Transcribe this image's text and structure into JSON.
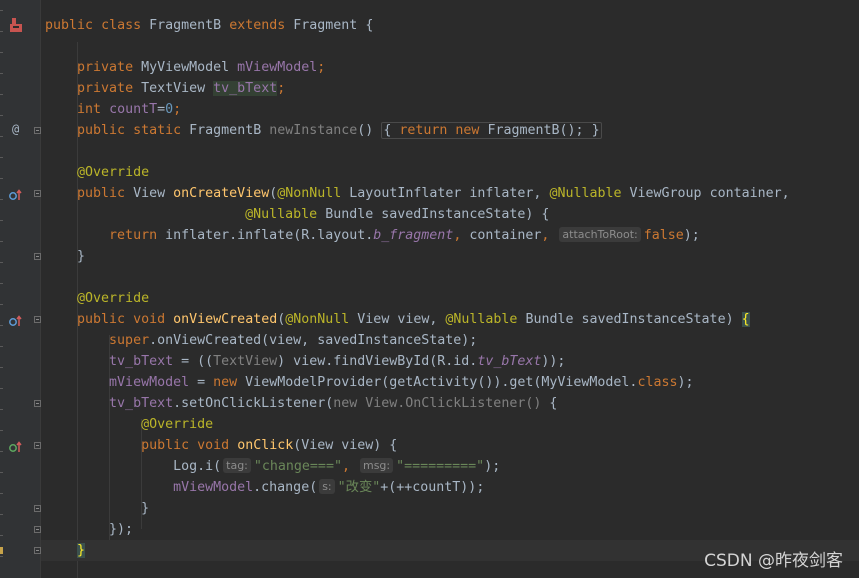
{
  "tokens": {
    "public": "public",
    "private": "private",
    "class": "class",
    "extends": "extends",
    "static": "static",
    "return": "return",
    "new": "new",
    "int": "int",
    "void": "void",
    "super": "super",
    "lbrace": "{",
    "rbrace": "}"
  },
  "code": {
    "l1": {
      "name": "FragmentB",
      "parent": "Fragment"
    },
    "l3": {
      "type": "MyViewModel",
      "field": "mViewModel",
      "semi": ";"
    },
    "l4": {
      "type": "TextView",
      "field": "tv_bText",
      "semi": ";"
    },
    "l5": {
      "field": "countT",
      "eq": "=",
      "num": "0",
      "semi": ";"
    },
    "l6": {
      "ret": "FragmentB",
      "method": "newInstance",
      "parens": "()",
      "call": "FragmentB();"
    },
    "l8": {
      "annotation": "@Override"
    },
    "l9": {
      "type": "View",
      "method": "onCreateView",
      "ann1": "@NonNull",
      "p1": "LayoutInflater inflater, ",
      "ann2": "@Nullable",
      "p2": "ViewGroup container,",
      "indent": "                        "
    },
    "l10": {
      "indent": "                         ",
      "ann": "@Nullable",
      "p": "Bundle savedInstanceState) {"
    },
    "l11": {
      "indent": "        ",
      "pre": "inflater.inflate(R.layout.",
      "layout": "b_fragment",
      "mid": ", container, ",
      "hint": "attachToRoot:",
      "val": "false",
      "end": ");"
    },
    "l12": {
      "indent": "    "
    },
    "l14": {
      "annotation": "@Override"
    },
    "l15": {
      "method": "onViewCreated",
      "ann1": "@NonNull",
      "p1": "View view, ",
      "ann2": "@Nullable",
      "p2": "Bundle savedInstanceState) ",
      "lparen": "("
    },
    "l16": {
      "indent": "        ",
      "rest": ".onViewCreated(view, savedInstanceState);"
    },
    "l17": {
      "indent": "        ",
      "field": "tv_bText",
      "a": " = ((",
      "cast": "TextView",
      "b": ") view.findViewById(R.id.",
      "id": "tv_bText",
      "c": "));"
    },
    "l18": {
      "indent": "        ",
      "field": "mViewModel",
      "a": " = ",
      "b": " ViewModelProvider(getActivity()).get(MyViewModel.",
      "c": ");"
    },
    "l19": {
      "indent": "        ",
      "field": "tv_bText",
      "a": ".setOnClickListener(",
      "b": "new View.OnClickListener()",
      "c": " {"
    },
    "l20": {
      "indent": "            ",
      "annotation": "@Override"
    },
    "l21": {
      "indent": "            ",
      "method": "onClick",
      "p": "(View view) {"
    },
    "l22": {
      "indent": "                ",
      "pre": "Log.i(",
      "hint1": "tag:",
      "s1": "\"change===\"",
      "comma": ",",
      "hint2": "msg:",
      "s2": "\"=========\"",
      "end": ");"
    },
    "l23": {
      "indent": "                ",
      "field": "mViewModel",
      "a": ".change(",
      "hint": "s:",
      "s": "\"改变\"",
      "b": "+(++countT));"
    },
    "l24": {
      "indent": "            "
    },
    "l25": {
      "indent": "        ",
      "text": "});"
    },
    "l26": {
      "indent": "    "
    }
  },
  "gutter_icons": {
    "class_icon": "class-run-icon",
    "at_icon": "@",
    "override_icon": "override-implementation-icon"
  },
  "watermark": "CSDN @昨夜剑客",
  "colors": {
    "background": "#2b2b2b",
    "keyword": "#cc7832",
    "annotation": "#bbb529",
    "field": "#9876aa",
    "method": "#ffc66d",
    "string": "#6a8759",
    "number": "#6897bb"
  }
}
